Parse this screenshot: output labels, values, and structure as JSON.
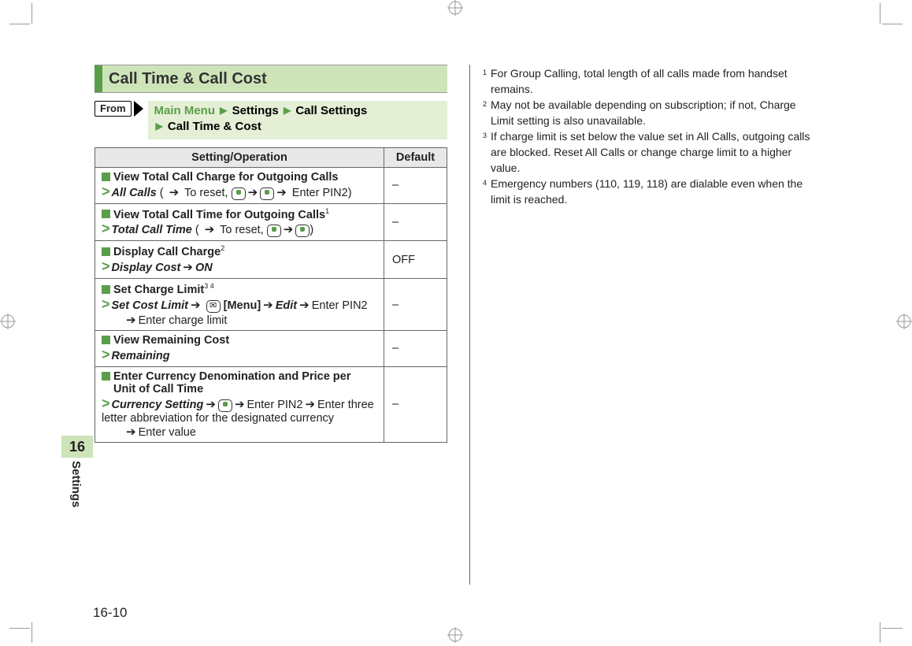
{
  "section_title": "Call Time & Call Cost",
  "from_label": "From",
  "breadcrumb": {
    "main": "Main Menu",
    "p1": "Settings",
    "p2": "Call Settings",
    "p3": "Call Time & Cost"
  },
  "table": {
    "col_setting": "Setting/Operation",
    "col_default": "Default",
    "rows": [
      {
        "title": "View Total Call Charge for Outgoing Calls",
        "path_em": "All Calls",
        "path_tail_a": " ( ",
        "path_tail_b": " To reset, ",
        "path_tail_c": " Enter PIN2)",
        "sup": "",
        "default": "–"
      },
      {
        "title": "View Total Call Time for Outgoing Calls",
        "path_em": "Total Call Time",
        "path_tail_a": " ( ",
        "path_tail_b": " To reset, ",
        "path_tail_c": ")",
        "sup": "1",
        "default": "–"
      },
      {
        "title": "Display Call Charge",
        "path_em": "Display Cost",
        "path_tail": "ON",
        "sup": "2",
        "default": "OFF"
      },
      {
        "title": "Set Charge Limit",
        "path_em": "Set Cost Limit",
        "menu_label": "[Menu]",
        "edit_label": "Edit",
        "pin2": "Enter PIN2",
        "enter_limit": "Enter charge limit",
        "sup": "3 4",
        "default": "–"
      },
      {
        "title": "View Remaining Cost",
        "path_em": "Remaining",
        "sup": "",
        "default": "–"
      },
      {
        "title": "Enter Currency Denomination and Price per Unit of Call Time",
        "path_em": "Currency Setting",
        "pin2": "Enter PIN2",
        "enter_abbrev": "Enter three letter abbreviation for the designated currency",
        "enter_value": "Enter value",
        "sup": "",
        "default": "–"
      }
    ]
  },
  "footnotes": [
    {
      "n": "1",
      "text": "For Group Calling, total length of all calls made from handset remains."
    },
    {
      "n": "2",
      "text": "May not be available depending on subscription; if not, Charge Limit setting is also unavailable."
    },
    {
      "n": "3",
      "text": "If charge limit is set below the value set in All Calls, outgoing calls are blocked. Reset All Calls or change charge limit to a higher value."
    },
    {
      "n": "4",
      "text": "Emergency numbers (110, 119, 118) are dialable even when the limit is reached."
    }
  ],
  "sidetab": {
    "num": "16",
    "label": "Settings"
  },
  "page_number": "16-10",
  "glyphs": {
    "arrow": "➔",
    "tri": "▶"
  }
}
